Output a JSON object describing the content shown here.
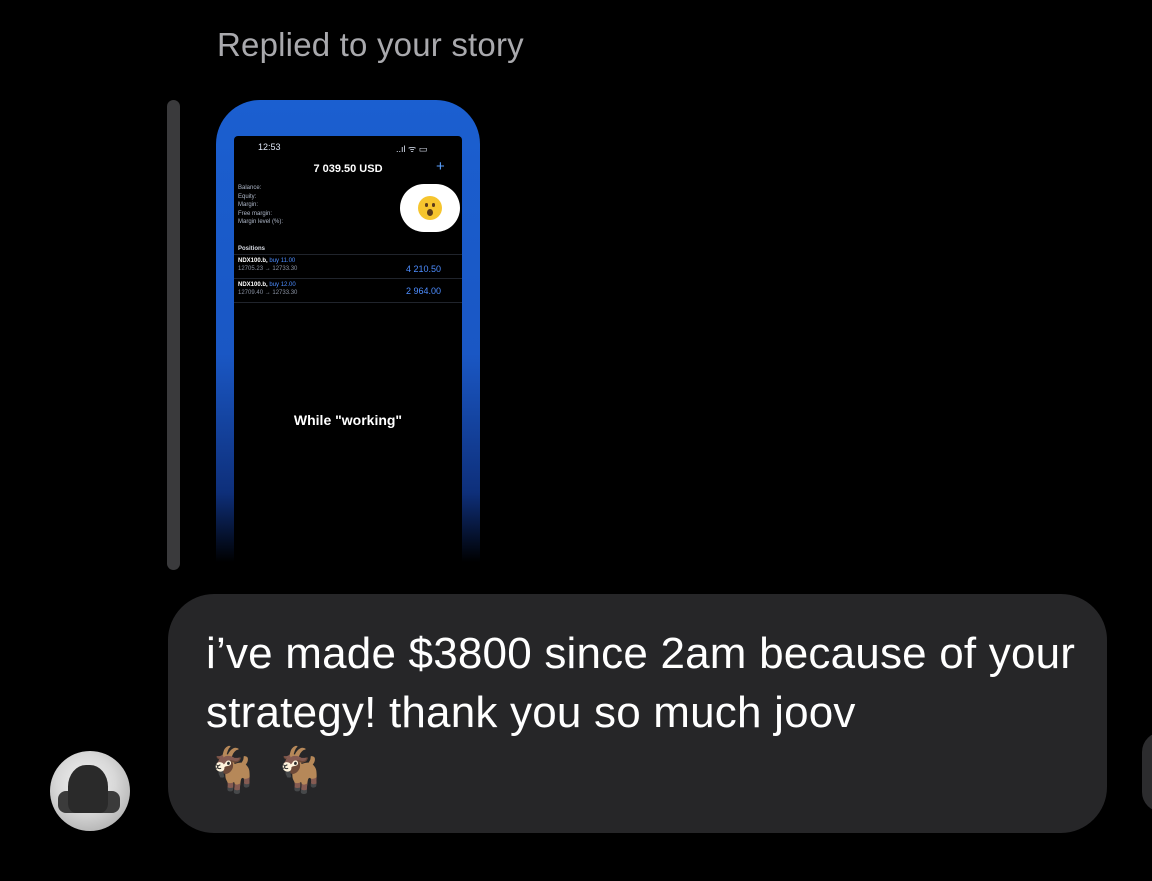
{
  "reply_caption": "Replied to your story",
  "story": {
    "status_time": "12:53",
    "status_signal": "..ıl ᯤ ▭",
    "balance": "7 039.50 USD",
    "account_fields": [
      "Balance:",
      "Equity:",
      "Margin:",
      "Free margin:",
      "Margin level (%):"
    ],
    "positions_header": "Positions",
    "positions": [
      {
        "symbol": "NDX100.b,",
        "side": "buy 11.00",
        "range": "12705.23 → 12733.30",
        "profit": "4 210.50"
      },
      {
        "symbol": "NDX100.b,",
        "side": "buy 12.00",
        "range": "12709.40 → 12733.30",
        "profit": "2 964.00"
      }
    ],
    "caption": "While \"working\"",
    "reaction": "surprised-face"
  },
  "message": {
    "text": "i’ve made $3800 since 2am because of your strategy! thank you so much joov",
    "emojis": "🐐 🐐"
  },
  "colors": {
    "background": "#000000",
    "bubble": "#262628",
    "caption": "#a9a9ad",
    "story_blue": "#1b5fd0"
  }
}
